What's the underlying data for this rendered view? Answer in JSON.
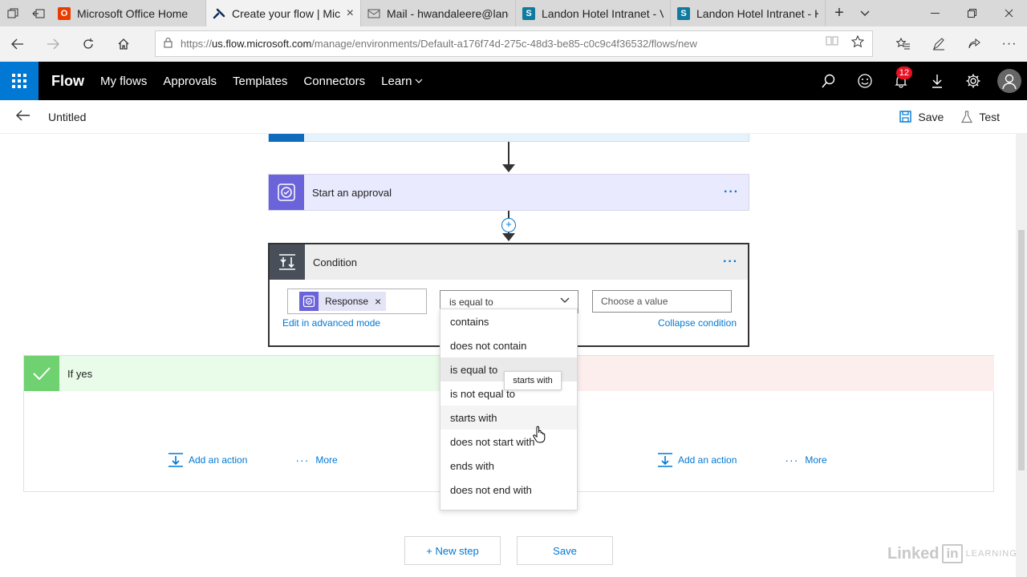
{
  "browser": {
    "tabs": [
      {
        "title": "Microsoft Office Home",
        "icon": "office-icon",
        "active": false
      },
      {
        "title": "Create your flow | Mic",
        "icon": "flow-icon",
        "active": true
      },
      {
        "title": "Mail - hwandaleere@land",
        "icon": "mail-icon",
        "active": false
      },
      {
        "title": "Landon Hotel Intranet - Ve",
        "icon": "sharepoint-icon",
        "active": false
      },
      {
        "title": "Landon Hotel Intranet - H",
        "icon": "sharepoint-icon",
        "active": false
      }
    ],
    "url_prefix": "https://",
    "url_host": "us.flow.microsoft.com",
    "url_path": "/manage/environments/Default-a176f74d-275c-48d3-be85-c0c9c4f36532/flows/new"
  },
  "header": {
    "brand": "Flow",
    "nav": [
      "My flows",
      "Approvals",
      "Templates",
      "Connectors",
      "Learn"
    ],
    "notification_count": "12"
  },
  "command_bar": {
    "flow_name": "Untitled",
    "save_label": "Save",
    "test_label": "Test"
  },
  "canvas": {
    "approval_card": {
      "title": "Start an approval"
    },
    "condition_card": {
      "title": "Condition",
      "token_label": "Response",
      "operator_selected": "is equal to",
      "value_placeholder": "Choose a value",
      "advanced_link": "Edit in advanced mode",
      "collapse_link": "Collapse condition"
    },
    "operator_options": [
      "contains",
      "does not contain",
      "is equal to",
      "is not equal to",
      "starts with",
      "does not start with",
      "ends with",
      "does not end with"
    ],
    "tooltip": "starts with",
    "branch_yes": {
      "title": "If yes",
      "add_action": "Add an action",
      "more": "More"
    },
    "branch_no": {
      "add_action": "Add an action",
      "more": "More"
    },
    "new_step_label": "+ New step",
    "save_button_label": "Save"
  },
  "watermark": {
    "text": "Linked",
    "in": "in",
    "suffix": "LEARNING"
  },
  "colors": {
    "accent": "#0078d4",
    "header_bg": "#000000",
    "approval_purple": "#6b63d9",
    "yes_green": "#6fd16f",
    "badge_red": "#e81123"
  }
}
